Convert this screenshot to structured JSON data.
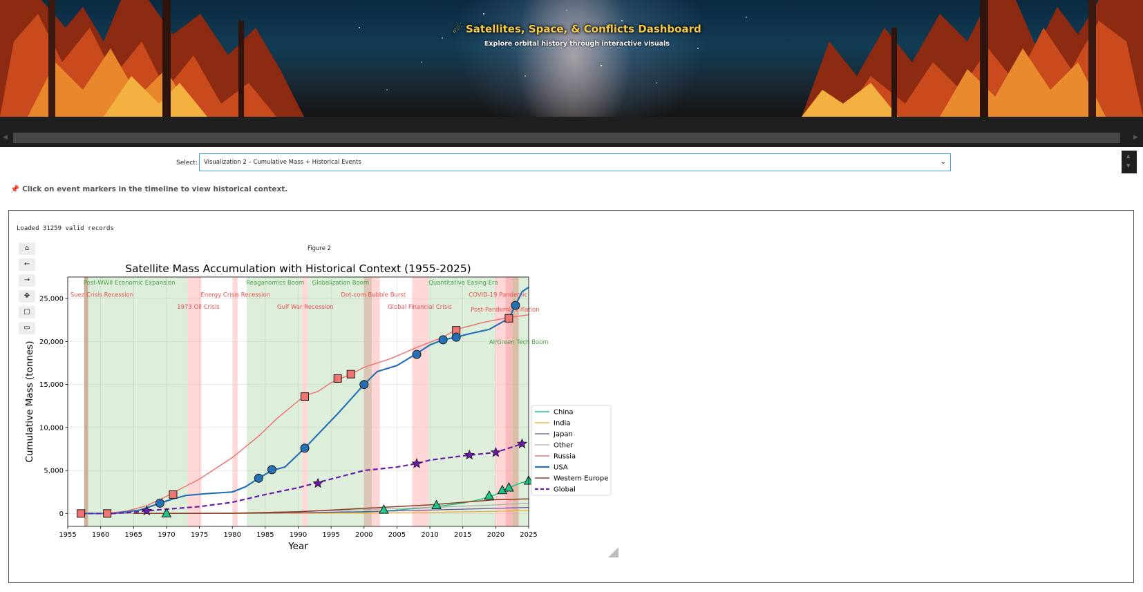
{
  "banner": {
    "title": "Satellites, Space, & Conflicts Dashboard",
    "subtitle": "Explore orbital history through interactive visuals"
  },
  "select": {
    "label": "Select:",
    "value": "Visualization 2 – Cumulative Mass + Historical Events"
  },
  "hint": "Click on event markers in the timeline to view historical context.",
  "output": {
    "loaded_text": "Loaded 31259 valid records",
    "figure_label": "Figure 2"
  },
  "toolbar": {
    "buttons": [
      {
        "name": "home-icon",
        "glyph": "⌂"
      },
      {
        "name": "back-icon",
        "glyph": "←"
      },
      {
        "name": "forward-icon",
        "glyph": "→"
      },
      {
        "name": "pan-icon",
        "glyph": "✥"
      },
      {
        "name": "zoom-rect-icon",
        "glyph": "□"
      },
      {
        "name": "save-icon",
        "glyph": "▭"
      }
    ]
  },
  "chart_data": {
    "type": "line",
    "title": "Satellite Mass Accumulation with Historical Context (1955-2025)",
    "xlabel": "Year",
    "ylabel": "Cumulative Mass (tonnes)",
    "xlim": [
      1955,
      2025
    ],
    "ylim": [
      -1500,
      27500
    ],
    "xticks": [
      1955,
      1960,
      1965,
      1970,
      1975,
      1980,
      1985,
      1990,
      1995,
      2000,
      2005,
      2010,
      2015,
      2020,
      2025
    ],
    "yticks": [
      0,
      5000,
      10000,
      15000,
      20000,
      25000
    ],
    "ytick_labels": [
      "0",
      "5,000",
      "10,000",
      "15,000",
      "20,000",
      "25,000"
    ],
    "grid": true,
    "legend_position": "right",
    "bands": [
      {
        "start": 1957.5,
        "end": 1958.1,
        "kind": "conflict",
        "color": "#c9a88e"
      },
      {
        "start": 1958.1,
        "end": 1973.2,
        "kind": "expansion",
        "color": "#d9ecd6"
      },
      {
        "start": 1973.2,
        "end": 1975.3,
        "kind": "recession",
        "color": "#ffd3d3"
      },
      {
        "start": 1980.1,
        "end": 1980.8,
        "kind": "recession",
        "color": "#ffd3d3"
      },
      {
        "start": 1982.2,
        "end": 1990.6,
        "kind": "expansion",
        "color": "#d9ecd6"
      },
      {
        "start": 1990.6,
        "end": 1991.4,
        "kind": "recession",
        "color": "#ffd3d3"
      },
      {
        "start": 1991.4,
        "end": 2000.0,
        "kind": "expansion",
        "color": "#d9ecd6"
      },
      {
        "start": 2000.0,
        "end": 2001.2,
        "kind": "conflict",
        "color": "#d9c0ad"
      },
      {
        "start": 2001.2,
        "end": 2002.4,
        "kind": "recession",
        "color": "#ffd3d3"
      },
      {
        "start": 2007.3,
        "end": 2009.8,
        "kind": "recession",
        "color": "#ffd3d3"
      },
      {
        "start": 2009.8,
        "end": 2019.9,
        "kind": "expansion",
        "color": "#d9ecd6"
      },
      {
        "start": 2019.9,
        "end": 2021.5,
        "kind": "recession",
        "color": "#ffd3d3"
      },
      {
        "start": 2021.5,
        "end": 2022.5,
        "kind": "recession",
        "color": "#f7b3b3"
      },
      {
        "start": 2022.5,
        "end": 2023.5,
        "kind": "conflict",
        "color": "#d8b6a0"
      },
      {
        "start": 2023.5,
        "end": 2025.0,
        "kind": "expansion",
        "color": "#d9ecd6"
      }
    ],
    "events": [
      {
        "label": "Post-WWII Economic Expansion",
        "x": 1957.4,
        "y": 26600,
        "color": "#3a9a3a"
      },
      {
        "label": "Suez Crisis Recession",
        "x": 1955.4,
        "y": 25200,
        "color": "#e8413f"
      },
      {
        "label": "1973 Oil Crisis",
        "x": 1971.6,
        "y": 23800,
        "color": "#e8413f"
      },
      {
        "label": "Energy Crisis Recession",
        "x": 1975.2,
        "y": 25200,
        "color": "#e8413f"
      },
      {
        "label": "Reaganomics Boom",
        "x": 1982.1,
        "y": 26600,
        "color": "#3a9a3a"
      },
      {
        "label": "Gulf War Recession",
        "x": 1986.8,
        "y": 23800,
        "color": "#e8413f"
      },
      {
        "label": "Globalization Boom",
        "x": 1992.1,
        "y": 26600,
        "color": "#3a9a3a"
      },
      {
        "label": "Dot-com Bubble Burst",
        "x": 1996.5,
        "y": 25200,
        "color": "#e8413f"
      },
      {
        "label": "Global Financial Crisis",
        "x": 2003.6,
        "y": 23800,
        "color": "#e8413f"
      },
      {
        "label": "Quantitative Easing Era",
        "x": 2009.8,
        "y": 26600,
        "color": "#3a9a3a"
      },
      {
        "label": "COVID-19 Pandemic",
        "x": 2015.9,
        "y": 25200,
        "color": "#e8413f"
      },
      {
        "label": "Post-Pandemic Inflation",
        "x": 2016.2,
        "y": 23500,
        "color": "#e8413f"
      },
      {
        "label": "AI/Green Tech Boom",
        "x": 2019.0,
        "y": 19700,
        "color": "#3a9a3a"
      }
    ],
    "series": [
      {
        "name": "China",
        "color": "#1fc487",
        "style": "solid",
        "width": 1.5,
        "x": [
          1970,
          1980,
          1990,
          2000,
          2005,
          2010,
          2015,
          2018,
          2020,
          2022,
          2024,
          2025
        ],
        "y": [
          0,
          10,
          60,
          150,
          400,
          700,
          1200,
          1700,
          2200,
          3000,
          3600,
          3800
        ],
        "markers": {
          "shape": "triangle",
          "x": [
            1970,
            2003,
            2011,
            2019,
            2021,
            2022,
            2025
          ],
          "y": [
            0,
            420,
            950,
            2050,
            2700,
            3000,
            3800
          ]
        }
      },
      {
        "name": "India",
        "color": "#f5a623",
        "style": "solid",
        "width": 1.2,
        "x": [
          1975,
          1990,
          2000,
          2010,
          2020,
          2025
        ],
        "y": [
          0,
          20,
          60,
          120,
          250,
          350
        ]
      },
      {
        "name": "Japan",
        "color": "#6a51a3",
        "style": "solid",
        "width": 1.2,
        "x": [
          1970,
          1985,
          1995,
          2005,
          2015,
          2025
        ],
        "y": [
          0,
          40,
          150,
          300,
          500,
          700
        ]
      },
      {
        "name": "Other",
        "color": "#aaaaaa",
        "style": "solid",
        "width": 1.2,
        "x": [
          1962,
          1980,
          1990,
          2000,
          2010,
          2020,
          2025
        ],
        "y": [
          0,
          40,
          200,
          450,
          700,
          1000,
          1200
        ]
      },
      {
        "name": "Russia",
        "color": "#f07470",
        "style": "solid",
        "width": 1.5,
        "x": [
          1957,
          1961,
          1964,
          1967,
          1970,
          1975,
          1980,
          1984,
          1987,
          1991,
          1993,
          1995,
          1998,
          2000,
          2004,
          2008,
          2012,
          2014,
          2018,
          2022,
          2025
        ],
        "y": [
          0,
          0,
          300,
          900,
          2000,
          4000,
          6500,
          9000,
          11200,
          13700,
          14200,
          15200,
          16200,
          17000,
          18000,
          19300,
          20500,
          21400,
          22200,
          22800,
          23100
        ],
        "markers": {
          "shape": "square",
          "x": [
            1957,
            1961,
            1971,
            1991,
            1996,
            1998,
            2014,
            2022
          ],
          "y": [
            0,
            0,
            2200,
            13600,
            15700,
            16200,
            21300,
            22700
          ]
        }
      },
      {
        "name": "USA",
        "color": "#2671b5",
        "style": "solid",
        "width": 2.2,
        "x": [
          1957,
          1962,
          1966,
          1969,
          1971,
          1973,
          1976,
          1980,
          1982,
          1984,
          1986,
          1988,
          1991,
          1993,
          1996,
          1998,
          2000,
          2002,
          2005,
          2008,
          2010,
          2012,
          2014,
          2016,
          2019,
          2022,
          2023,
          2024,
          2025
        ],
        "y": [
          0,
          0,
          400,
          1200,
          1700,
          2100,
          2300,
          2500,
          3100,
          4100,
          5000,
          5400,
          7600,
          9200,
          11600,
          13300,
          15000,
          16500,
          17200,
          18600,
          19600,
          20200,
          20500,
          20900,
          21400,
          22700,
          24200,
          25800,
          26300
        ],
        "markers": {
          "shape": "circle",
          "x": [
            1969,
            1984,
            1986,
            1991,
            2000,
            2008,
            2012,
            2014,
            2023
          ],
          "y": [
            1200,
            4100,
            5100,
            7600,
            15000,
            18500,
            20200,
            20500,
            24200
          ]
        }
      },
      {
        "name": "Western Europe",
        "color": "#8c3b1f",
        "style": "solid",
        "width": 1.5,
        "x": [
          1965,
          1980,
          1990,
          2000,
          2005,
          2010,
          2015,
          2020,
          2025
        ],
        "y": [
          0,
          30,
          200,
          600,
          800,
          1000,
          1300,
          1600,
          1700
        ]
      },
      {
        "name": "Global",
        "color": "#6a1aa8",
        "style": "dashed",
        "width": 2.2,
        "x": [
          1957,
          1962,
          1965,
          1967,
          1970,
          1975,
          1980,
          1985,
          1990,
          1995,
          2000,
          2005,
          2008,
          2010,
          2015,
          2020,
          2024
        ],
        "y": [
          0,
          0,
          150,
          300,
          500,
          800,
          1300,
          2200,
          3000,
          4000,
          5000,
          5400,
          5800,
          6200,
          6700,
          7100,
          8100
        ],
        "markers": {
          "shape": "star",
          "x": [
            1967,
            1993,
            2008,
            2016,
            2020,
            2024
          ],
          "y": [
            300,
            3500,
            5800,
            6800,
            7100,
            8100
          ]
        }
      }
    ]
  }
}
